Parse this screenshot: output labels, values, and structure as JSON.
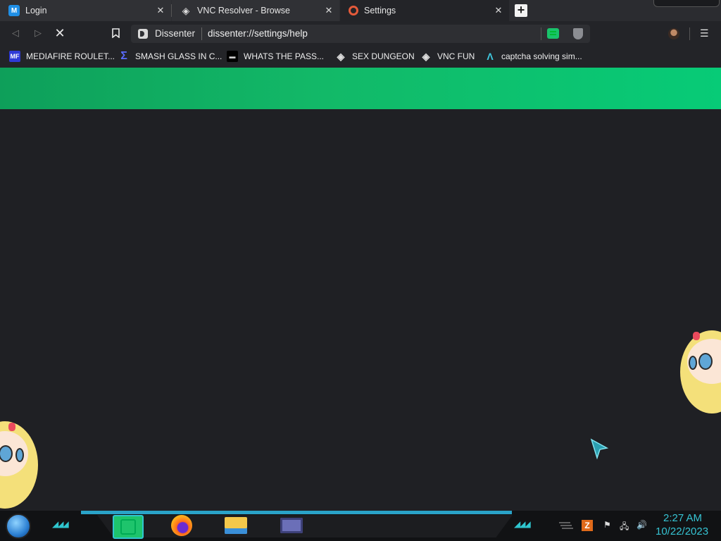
{
  "tabs": [
    {
      "title": "Login",
      "icon": "m-logo-icon"
    },
    {
      "title": "VNC Resolver - Browse",
      "icon": "vnc-logo-icon"
    },
    {
      "title": "Settings",
      "icon": "settings-gear-icon"
    }
  ],
  "tab_close_glyph": "✕",
  "new_tab_glyph": "+",
  "toolbar": {
    "back_glyph": "◁",
    "forward_glyph": "▷",
    "stop_glyph": "✕",
    "bookmark_glyph": "🔖"
  },
  "address": {
    "site_name": "Dissenter",
    "url": "dissenter://settings/help"
  },
  "menu_glyph": "☰",
  "bookmarks": [
    {
      "label": "MEDIAFIRE ROULET...",
      "icon": "mediafire-icon",
      "icon_text": "MF",
      "icon_bg": "#2f3bd6",
      "icon_fg": "#ffffff"
    },
    {
      "label": "SMASH GLASS IN C...",
      "icon": "sigma-icon",
      "icon_text": "Σ",
      "icon_bg": "#23243a",
      "icon_fg": "#5a6cff"
    },
    {
      "label": "WHATS THE PASS...",
      "icon": "terminal-icon",
      "icon_text": "▬",
      "icon_bg": "#000000",
      "icon_fg": "#cccccc"
    },
    {
      "label": "SEX DUNGEON",
      "icon": "vnc-logo-icon",
      "icon_text": "◈",
      "icon_bg": "#232428",
      "icon_fg": "#dddddd"
    },
    {
      "label": "VNC FUN",
      "icon": "vnc-logo-icon",
      "icon_text": "◈",
      "icon_bg": "#232428",
      "icon_fg": "#dddddd"
    },
    {
      "label": "captcha solving sim...",
      "icon": "lambda-icon",
      "icon_text": "Λ",
      "icon_bg": "#232428",
      "icon_fg": "#3fc9e0"
    }
  ],
  "colors": {
    "banner_start": "#0e9f5a",
    "banner_end": "#07cb77",
    "page_bg": "#1f2024",
    "clock": "#36c3d2"
  },
  "taskbar": {
    "chevrons": "◢◢◢",
    "chevrons_right": "◢◢◢",
    "tray_icons": [
      "show-desktop-icon",
      "app-tray-icon",
      "flag-icon",
      "network-icon",
      "volume-icon"
    ],
    "tray_glyphs": {
      "flag": "⚑",
      "network": "🖧",
      "volume": "🔊",
      "app": "Z"
    },
    "time": "2:27 AM",
    "date": "10/22/2023"
  }
}
